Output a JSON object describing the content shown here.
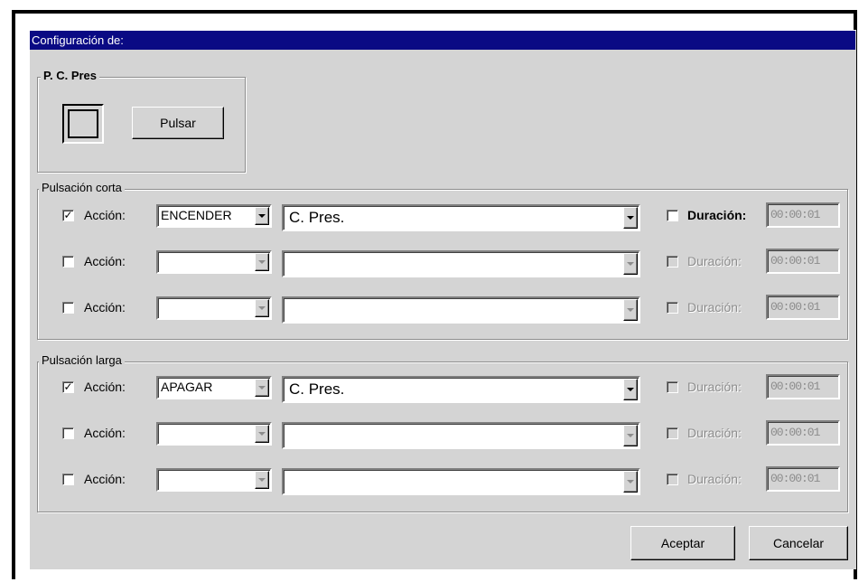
{
  "window": {
    "title": "Configuración de:"
  },
  "device_group": {
    "legend": "P. C. Pres",
    "button_label": "Pulsar",
    "icon": "device-square-icon"
  },
  "short_press": {
    "legend": "Pulsación corta",
    "rows": [
      {
        "checked": true,
        "label": "Acción:",
        "action": "ENCENDER",
        "target": "C. Pres.",
        "duration_checked": false,
        "duration_label": "Duración:",
        "duration": "00:00:01",
        "enabled": true,
        "duration_enabled": true
      },
      {
        "checked": false,
        "label": "Acción:",
        "action": "",
        "target": "",
        "duration_checked": false,
        "duration_label": "Duración:",
        "duration": "00:00:01",
        "enabled": false,
        "duration_enabled": false
      },
      {
        "checked": false,
        "label": "Acción:",
        "action": "",
        "target": "",
        "duration_checked": false,
        "duration_label": "Duración:",
        "duration": "00:00:01",
        "enabled": false,
        "duration_enabled": false
      }
    ]
  },
  "long_press": {
    "legend": "Pulsación larga",
    "rows": [
      {
        "checked": true,
        "label": "Acción:",
        "action": "APAGAR",
        "target": "C. Pres.",
        "duration_checked": false,
        "duration_label": "Duración:",
        "duration": "00:00:01",
        "enabled": true,
        "duration_enabled": false
      },
      {
        "checked": false,
        "label": "Acción:",
        "action": "",
        "target": "",
        "duration_checked": false,
        "duration_label": "Duración:",
        "duration": "00:00:01",
        "enabled": false,
        "duration_enabled": false
      },
      {
        "checked": false,
        "label": "Acción:",
        "action": "",
        "target": "",
        "duration_checked": false,
        "duration_label": "Duración:",
        "duration": "00:00:01",
        "enabled": false,
        "duration_enabled": false
      }
    ]
  },
  "footer": {
    "ok_label": "Aceptar",
    "cancel_label": "Cancelar"
  },
  "colors": {
    "titlebar": "#0a0a84",
    "face": "#d4d4d4",
    "disabled_text": "#8c8c8c"
  }
}
